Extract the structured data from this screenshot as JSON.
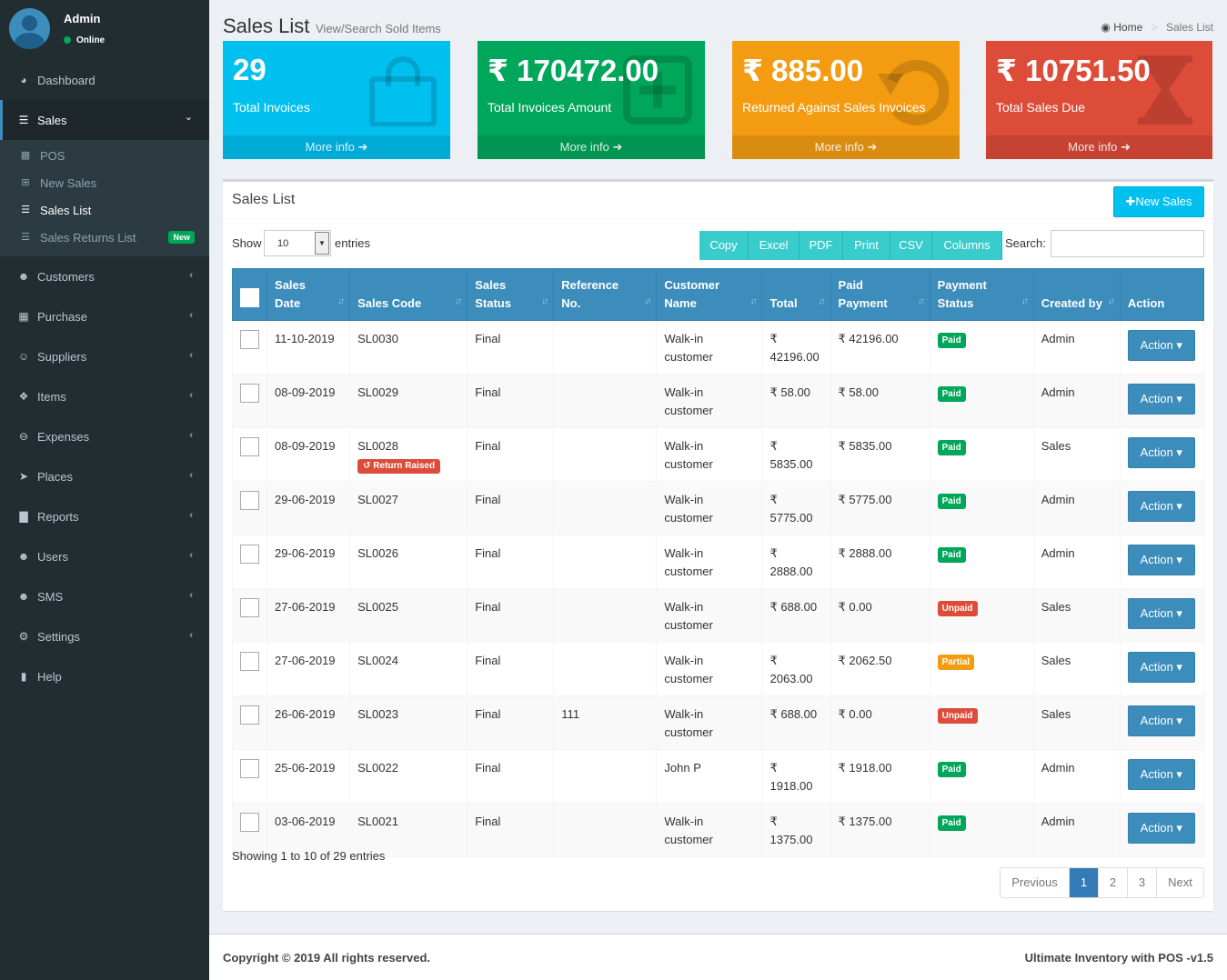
{
  "user": {
    "name": "Admin",
    "status": "Online"
  },
  "menu": [
    {
      "label": "Dashboard",
      "icon": "dashboard-icon",
      "chevron": false
    },
    {
      "label": "Sales",
      "icon": "cart-icon",
      "chevron": true,
      "active": true
    },
    {
      "label": "Customers",
      "icon": "users-icon",
      "chevron": true
    },
    {
      "label": "Purchase",
      "icon": "grid-icon",
      "chevron": true
    },
    {
      "label": "Suppliers",
      "icon": "user-plus-icon",
      "chevron": true
    },
    {
      "label": "Items",
      "icon": "cubes-icon",
      "chevron": true
    },
    {
      "label": "Expenses",
      "icon": "minus-circle-icon",
      "chevron": true
    },
    {
      "label": "Places",
      "icon": "paper-plane-icon",
      "chevron": true
    },
    {
      "label": "Reports",
      "icon": "bar-chart-icon",
      "chevron": true
    },
    {
      "label": "Users",
      "icon": "users-icon",
      "chevron": true
    },
    {
      "label": "SMS",
      "icon": "users-icon",
      "chevron": true
    },
    {
      "label": "Settings",
      "icon": "cogs-icon",
      "chevron": true
    },
    {
      "label": "Help",
      "icon": "book-icon",
      "chevron": false
    }
  ],
  "submenu": [
    {
      "label": "POS",
      "icon": "calculator-icon"
    },
    {
      "label": "New Sales",
      "icon": "plus-square-icon"
    },
    {
      "label": "Sales List",
      "icon": "list-icon",
      "active": true
    },
    {
      "label": "Sales Returns List",
      "icon": "list-icon",
      "badge": "New"
    }
  ],
  "header": {
    "title": "Sales List",
    "subtitle": "View/Search Sold Items",
    "breadcrumb_home": "Home",
    "breadcrumb_current": "Sales List"
  },
  "info_boxes": [
    {
      "value": "29",
      "label": "Total Invoices",
      "more": "More info",
      "color": "#00c0ef",
      "icon": "shopping-bag-icon"
    },
    {
      "value": "₹ 170472.00",
      "label": "Total Invoices Amount",
      "more": "More info",
      "color": "#00a65a",
      "icon": "plus-square-icon"
    },
    {
      "value": "₹ 885.00",
      "label": "Returned Against Sales Invoices",
      "more": "More info",
      "color": "#f39c12",
      "icon": "undo-icon"
    },
    {
      "value": "₹ 10751.50",
      "label": "Total Sales Due",
      "more": "More info",
      "color": "#dd4b39",
      "icon": "hourglass-icon"
    }
  ],
  "box": {
    "title": "Sales List",
    "new_button": "New Sales"
  },
  "controls": {
    "show": "Show",
    "entries_value": "10",
    "entries": "entries",
    "search": "Search:",
    "buttons": [
      "Copy",
      "Excel",
      "PDF",
      "Print",
      "CSV",
      "Columns"
    ]
  },
  "table": {
    "headers": [
      "Sales Date",
      "Sales Code",
      "Sales Status",
      "Reference No.",
      "Customer Name",
      "Total",
      "Paid Payment",
      "Payment Status",
      "Created by",
      "Action"
    ],
    "rows": [
      {
        "date": "11-10-2019",
        "code": "SL0030",
        "status": "Final",
        "ref": "",
        "customer": "Walk-in customer",
        "total": "₹ 42196.00",
        "paid": "₹ 42196.00",
        "pay_status": "Paid",
        "created": "Admin"
      },
      {
        "date": "08-09-2019",
        "code": "SL0029",
        "status": "Final",
        "ref": "",
        "customer": "Walk-in customer",
        "total": "₹ 58.00",
        "paid": "₹ 58.00",
        "pay_status": "Paid",
        "created": "Admin"
      },
      {
        "date": "08-09-2019",
        "code": "SL0028",
        "return_badge": "Return Raised",
        "status": "Final",
        "ref": "",
        "customer": "Walk-in customer",
        "total": "₹ 5835.00",
        "paid": "₹ 5835.00",
        "pay_status": "Paid",
        "created": "Sales"
      },
      {
        "date": "29-06-2019",
        "code": "SL0027",
        "status": "Final",
        "ref": "",
        "customer": "Walk-in customer",
        "total": "₹ 5775.00",
        "paid": "₹ 5775.00",
        "pay_status": "Paid",
        "created": "Admin"
      },
      {
        "date": "29-06-2019",
        "code": "SL0026",
        "status": "Final",
        "ref": "",
        "customer": "Walk-in customer",
        "total": "₹ 2888.00",
        "paid": "₹ 2888.00",
        "pay_status": "Paid",
        "created": "Admin"
      },
      {
        "date": "27-06-2019",
        "code": "SL0025",
        "status": "Final",
        "ref": "",
        "customer": "Walk-in customer",
        "total": "₹ 688.00",
        "paid": "₹ 0.00",
        "pay_status": "Unpaid",
        "created": "Sales"
      },
      {
        "date": "27-06-2019",
        "code": "SL0024",
        "status": "Final",
        "ref": "",
        "customer": "Walk-in customer",
        "total": "₹ 2063.00",
        "paid": "₹ 2062.50",
        "pay_status": "Partial",
        "created": "Sales"
      },
      {
        "date": "26-06-2019",
        "code": "SL0023",
        "status": "Final",
        "ref": "111",
        "customer": "Walk-in customer",
        "total": "₹ 688.00",
        "paid": "₹ 0.00",
        "pay_status": "Unpaid",
        "created": "Sales"
      },
      {
        "date": "25-06-2019",
        "code": "SL0022",
        "status": "Final",
        "ref": "",
        "customer": "John P",
        "total": "₹ 1918.00",
        "paid": "₹ 1918.00",
        "pay_status": "Paid",
        "created": "Admin"
      },
      {
        "date": "03-06-2019",
        "code": "SL0021",
        "status": "Final",
        "ref": "",
        "customer": "Walk-in customer",
        "total": "₹ 1375.00",
        "paid": "₹ 1375.00",
        "pay_status": "Paid",
        "created": "Admin"
      }
    ],
    "action_label": "Action"
  },
  "table_info": "Showing 1 to 10 of 29 entries",
  "pagination": {
    "previous": "Previous",
    "pages": [
      "1",
      "2",
      "3"
    ],
    "current": "1",
    "next": "Next"
  },
  "footer": {
    "copyright": "Copyright © 2019 All rights reserved.",
    "version": "Ultimate Inventory with POS -v1.5"
  }
}
